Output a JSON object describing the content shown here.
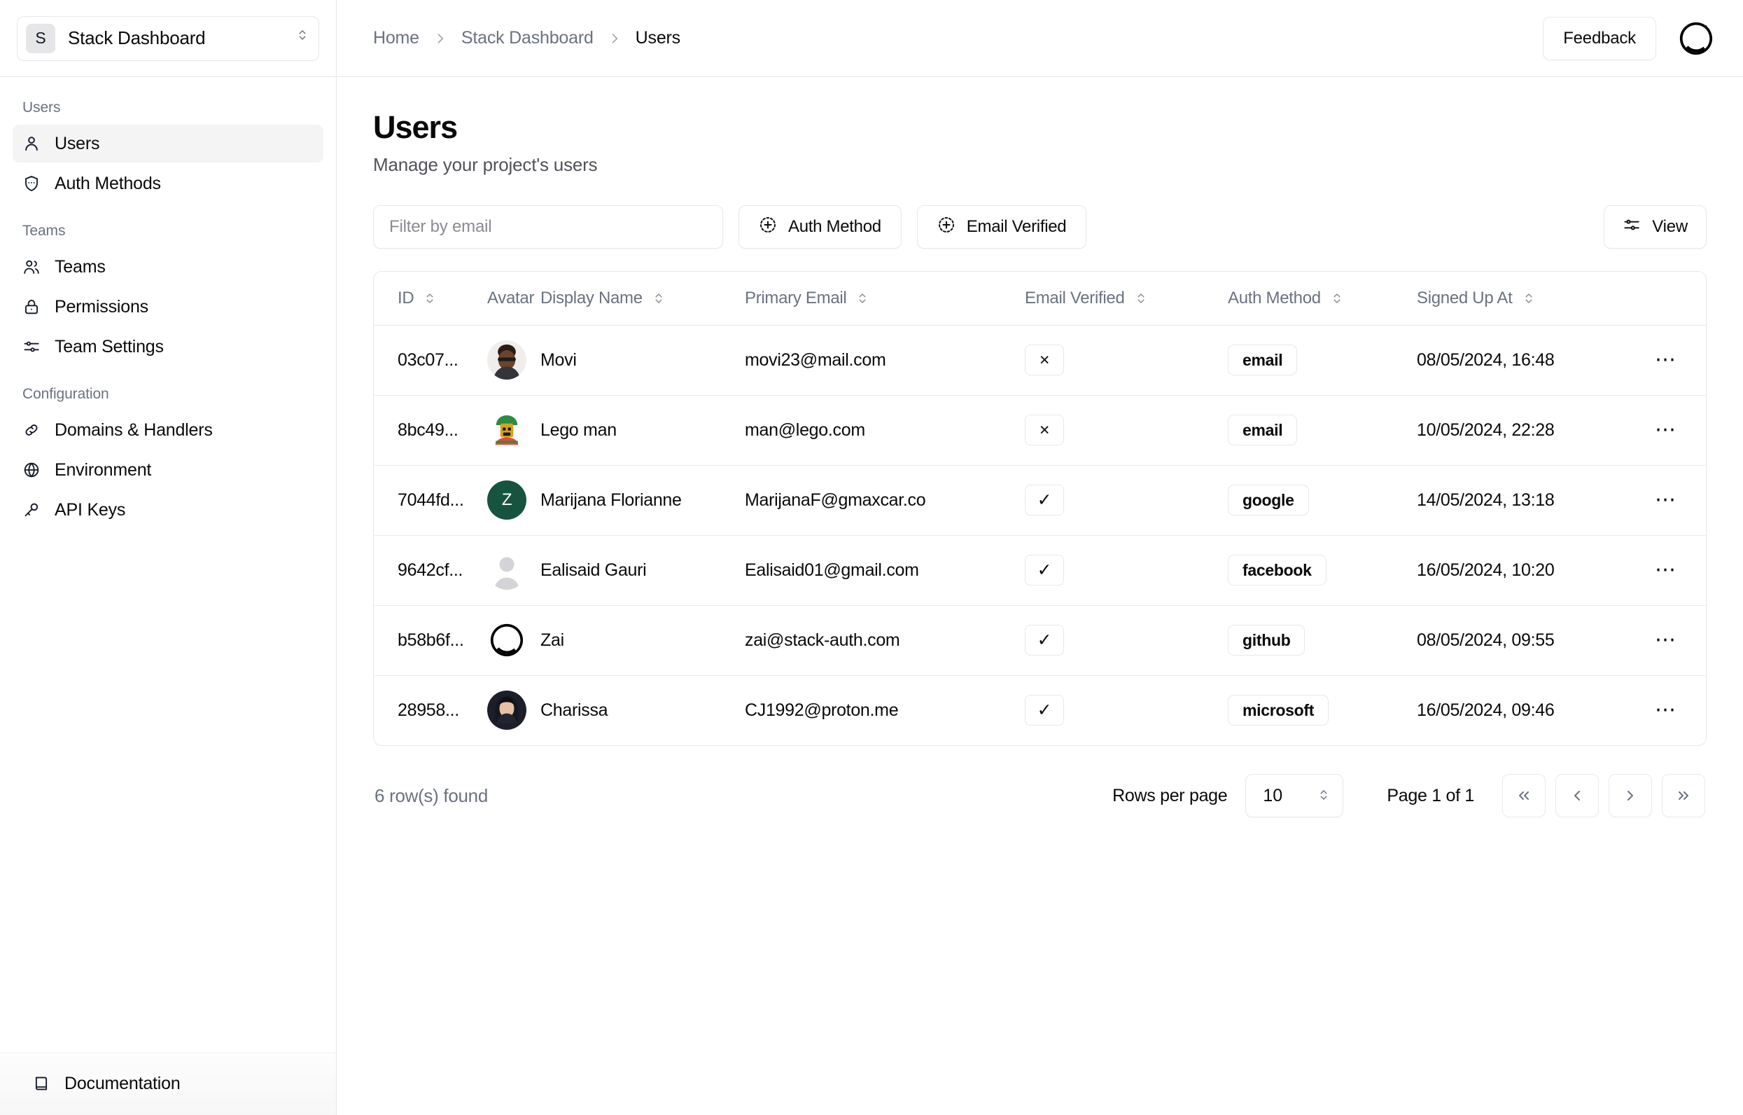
{
  "sidebar": {
    "project": {
      "badge": "S",
      "name": "Stack Dashboard"
    },
    "groups": [
      {
        "label": "Users",
        "items": [
          {
            "label": "Users",
            "icon": "user-icon",
            "active": true
          },
          {
            "label": "Auth Methods",
            "icon": "shield-icon",
            "active": false
          }
        ]
      },
      {
        "label": "Teams",
        "items": [
          {
            "label": "Teams",
            "icon": "users-icon",
            "active": false
          },
          {
            "label": "Permissions",
            "icon": "lock-icon",
            "active": false
          },
          {
            "label": "Team Settings",
            "icon": "sliders-icon",
            "active": false
          }
        ]
      },
      {
        "label": "Configuration",
        "items": [
          {
            "label": "Domains & Handlers",
            "icon": "link-icon",
            "active": false
          },
          {
            "label": "Environment",
            "icon": "globe-icon",
            "active": false
          },
          {
            "label": "API Keys",
            "icon": "key-icon",
            "active": false
          }
        ]
      }
    ],
    "footer": {
      "label": "Documentation",
      "icon": "book-icon"
    }
  },
  "topbar": {
    "breadcrumb": [
      "Home",
      "Stack Dashboard",
      "Users"
    ],
    "feedback_label": "Feedback",
    "avatar": "stack-auth-logo"
  },
  "page": {
    "title": "Users",
    "subtitle": "Manage your project's users"
  },
  "toolbar": {
    "filter_placeholder": "Filter by email",
    "filter_value": "",
    "auth_method_label": "Auth Method",
    "email_verified_label": "Email Verified",
    "view_label": "View"
  },
  "table": {
    "columns": [
      {
        "label": "ID",
        "sortable": true
      },
      {
        "label": "Avatar",
        "sortable": false
      },
      {
        "label": "Display Name",
        "sortable": true
      },
      {
        "label": "Primary Email",
        "sortable": true
      },
      {
        "label": "Email Verified",
        "sortable": true
      },
      {
        "label": "Auth Method",
        "sortable": true
      },
      {
        "label": "Signed Up At",
        "sortable": true
      },
      {
        "label": "",
        "sortable": false
      }
    ],
    "rows": [
      {
        "id": "03c07...",
        "avatar": {
          "type": "photo",
          "kind": "man-photo"
        },
        "name": "Movi",
        "email": "movi23@mail.com",
        "verified": false,
        "verified_glyph": "×",
        "auth": "email",
        "signed_up": "08/05/2024, 16:48"
      },
      {
        "id": "8bc49...",
        "avatar": {
          "type": "photo",
          "kind": "lego-photo"
        },
        "name": "Lego man",
        "email": "man@lego.com",
        "verified": false,
        "verified_glyph": "×",
        "auth": "email",
        "signed_up": "10/05/2024, 22:28"
      },
      {
        "id": "7044fd...",
        "avatar": {
          "type": "initial",
          "initial": "Z",
          "color": "#16543f"
        },
        "name": "Marijana Florianne",
        "email": "MarijanaF@gmaxcar.co",
        "verified": true,
        "verified_glyph": "✓",
        "auth": "google",
        "signed_up": "14/05/2024, 13:18"
      },
      {
        "id": "9642cf...",
        "avatar": {
          "type": "placeholder",
          "kind": "person-silhouette"
        },
        "name": "Ealisaid Gauri",
        "email": "Ealisaid01@gmail.com",
        "verified": true,
        "verified_glyph": "✓",
        "auth": "facebook",
        "signed_up": "16/05/2024, 10:20"
      },
      {
        "id": "b58b6f...",
        "avatar": {
          "type": "logo",
          "kind": "stack-auth-logo"
        },
        "name": "Zai",
        "email": "zai@stack-auth.com",
        "verified": true,
        "verified_glyph": "✓",
        "auth": "github",
        "signed_up": "08/05/2024, 09:55"
      },
      {
        "id": "28958...",
        "avatar": {
          "type": "photo",
          "kind": "woman-photo"
        },
        "name": "Charissa",
        "email": "CJ1992@proton.me",
        "verified": true,
        "verified_glyph": "✓",
        "auth": "microsoft",
        "signed_up": "16/05/2024, 09:46"
      }
    ],
    "row_actions_icon": "ellipsis-icon"
  },
  "footer": {
    "rows_found": "6 row(s) found",
    "rows_per_page_label": "Rows per page",
    "rows_per_page_value": "10",
    "page_label": "Page 1 of 1",
    "pagination": [
      {
        "name": "first-page",
        "glyph": "«"
      },
      {
        "name": "prev-page",
        "glyph": "‹"
      },
      {
        "name": "next-page",
        "glyph": "›"
      },
      {
        "name": "last-page",
        "glyph": "»"
      }
    ]
  }
}
